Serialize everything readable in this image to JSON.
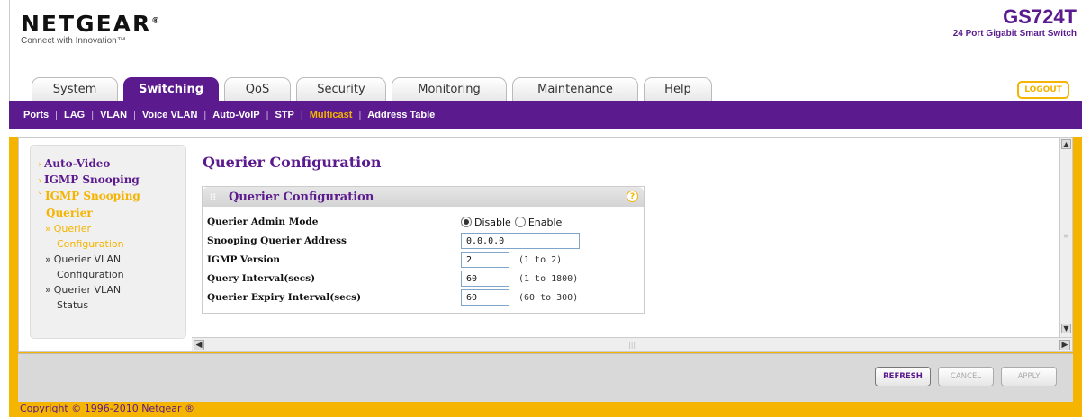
{
  "header": {
    "brand": "NETGEAR",
    "brand_mark": "®",
    "tagline": "Connect with Innovation™",
    "model": "GS724T",
    "model_desc": "24 Port Gigabit Smart Switch",
    "logout_label": "LOGOUT"
  },
  "tabs": [
    {
      "label": "System",
      "active": false
    },
    {
      "label": "Switching",
      "active": true
    },
    {
      "label": "QoS",
      "active": false
    },
    {
      "label": "Security",
      "active": false
    },
    {
      "label": "Monitoring",
      "active": false
    },
    {
      "label": "Maintenance",
      "active": false
    },
    {
      "label": "Help",
      "active": false
    }
  ],
  "subnav": {
    "items": [
      {
        "label": "Ports",
        "active": false
      },
      {
        "label": "LAG",
        "active": false
      },
      {
        "label": "VLAN",
        "active": false
      },
      {
        "label": "Voice VLAN",
        "active": false
      },
      {
        "label": "Auto-VoIP",
        "active": false
      },
      {
        "label": "STP",
        "active": false
      },
      {
        "label": "Multicast",
        "active": true
      },
      {
        "label": "Address Table",
        "active": false
      }
    ]
  },
  "sidebar": {
    "items": [
      {
        "label": "Auto-Video"
      },
      {
        "label": "IGMP Snooping"
      },
      {
        "label": "IGMP Snooping"
      }
    ],
    "group": "Querier",
    "subitems": [
      {
        "line1": "Querier",
        "line2": "Configuration",
        "active": true
      },
      {
        "line1": "Querier VLAN",
        "line2": "Configuration",
        "active": false
      },
      {
        "line1": "Querier VLAN",
        "line2": "Status",
        "active": false
      }
    ]
  },
  "page": {
    "title": "Querier Configuration",
    "panel_title": "Querier Configuration",
    "help_glyph": "?"
  },
  "form": {
    "admin_mode": {
      "label": "Querier Admin Mode",
      "options": [
        "Disable",
        "Enable"
      ],
      "selected": "Disable"
    },
    "address": {
      "label": "Snooping Querier Address",
      "value": "0.0.0.0"
    },
    "version": {
      "label": "IGMP Version",
      "value": "2",
      "range": "(1 to 2)"
    },
    "interval": {
      "label": "Query Interval(secs)",
      "value": "60",
      "range": "(1 to 1800)"
    },
    "expiry": {
      "label": "Querier Expiry Interval(secs)",
      "value": "60",
      "range": "(60 to 300)"
    }
  },
  "buttons": {
    "refresh": "REFRESH",
    "cancel": "CANCEL",
    "apply": "APPLY"
  },
  "footer": {
    "copyright": "Copyright © 1996-2010 Netgear ®"
  },
  "colors": {
    "brand_purple": "#5b1a8e",
    "accent_orange": "#f5b400"
  }
}
